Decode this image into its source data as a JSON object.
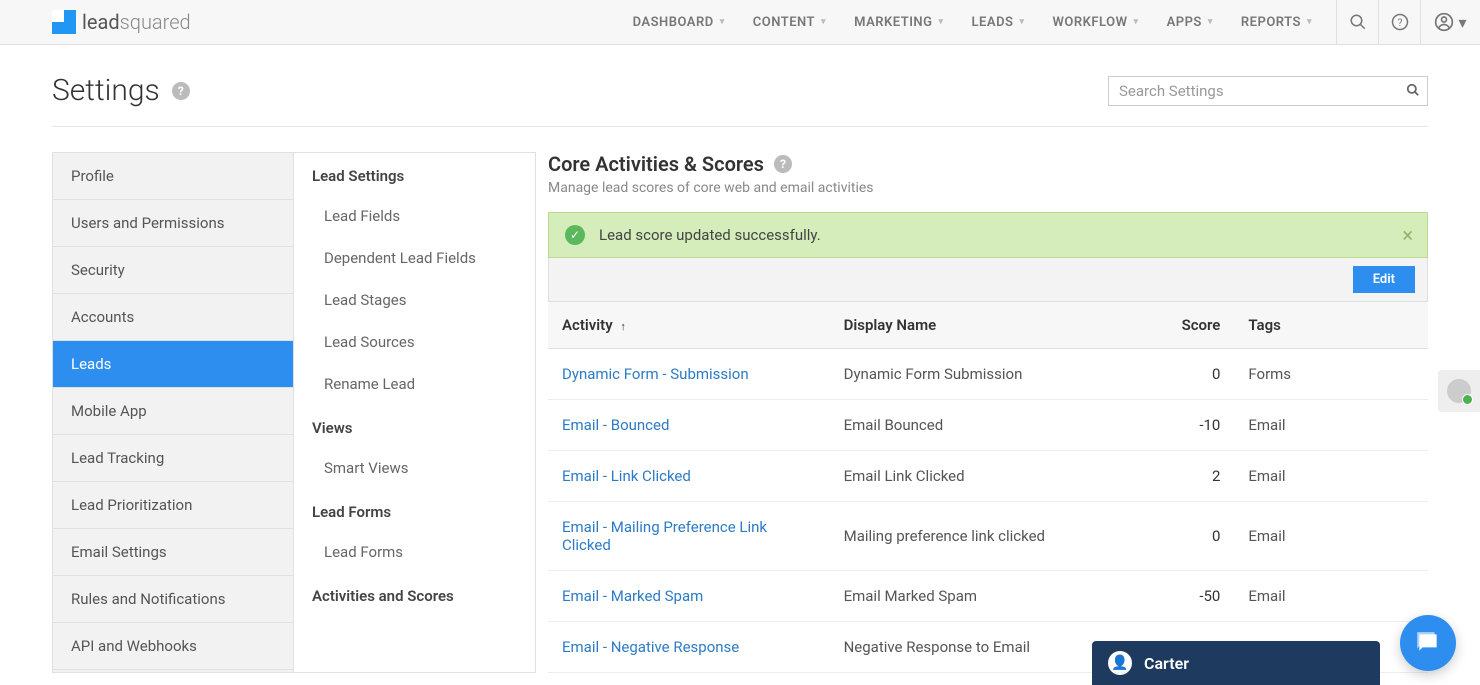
{
  "logo": {
    "lead": "lead",
    "squared": "squared"
  },
  "nav": {
    "items": [
      "DASHBOARD",
      "CONTENT",
      "MARKETING",
      "LEADS",
      "WORKFLOW",
      "APPS",
      "REPORTS"
    ]
  },
  "page": {
    "title": "Settings",
    "search_placeholder": "Search Settings"
  },
  "sidebar1": {
    "items": [
      "Profile",
      "Users and Permissions",
      "Security",
      "Accounts",
      "Leads",
      "Mobile App",
      "Lead Tracking",
      "Lead Prioritization",
      "Email Settings",
      "Rules and Notifications",
      "API and Webhooks"
    ],
    "active_index": 4
  },
  "sidebar2": {
    "groups": [
      {
        "heading": "Lead Settings",
        "items": [
          "Lead Fields",
          "Dependent Lead Fields",
          "Lead Stages",
          "Lead Sources",
          "Rename Lead"
        ]
      },
      {
        "heading": "Views",
        "items": [
          "Smart Views"
        ]
      },
      {
        "heading": "Lead Forms",
        "items": [
          "Lead Forms"
        ]
      },
      {
        "heading": "Activities and Scores",
        "items": []
      }
    ]
  },
  "main": {
    "title": "Core Activities & Scores",
    "subtitle": "Manage lead scores of core web and email activities",
    "alert": "Lead score updated successfully.",
    "edit_label": "Edit",
    "columns": {
      "activity": "Activity",
      "display": "Display Name",
      "score": "Score",
      "tags": "Tags"
    },
    "rows": [
      {
        "activity": "Dynamic Form - Submission",
        "display": "Dynamic Form Submission",
        "score": "0",
        "tags": "Forms"
      },
      {
        "activity": "Email - Bounced",
        "display": "Email Bounced",
        "score": "-10",
        "tags": "Email"
      },
      {
        "activity": "Email - Link Clicked",
        "display": "Email Link Clicked",
        "score": "2",
        "tags": "Email"
      },
      {
        "activity": "Email - Mailing Preference Link Clicked",
        "display": "Mailing preference link clicked",
        "score": "0",
        "tags": "Email"
      },
      {
        "activity": "Email - Marked Spam",
        "display": "Email Marked Spam",
        "score": "-50",
        "tags": "Email"
      },
      {
        "activity": "Email - Negative Response",
        "display": "Negative Response to Email",
        "score": "",
        "tags": ""
      }
    ]
  },
  "chat": {
    "name": "Carter"
  }
}
